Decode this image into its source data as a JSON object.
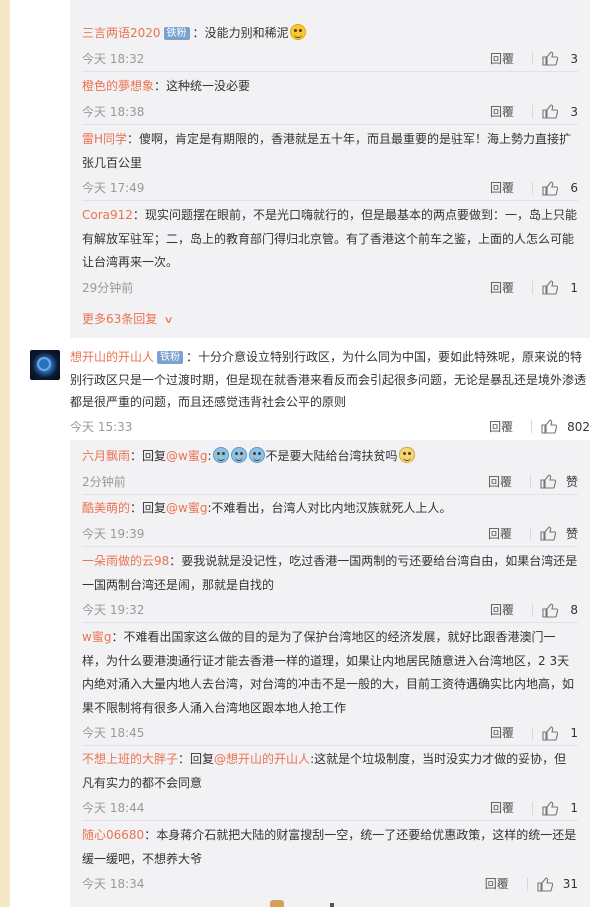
{
  "header": {
    "top_reply": "回覆",
    "top_like": "3"
  },
  "thread1": {
    "replies": [
      {
        "user": "三言两语2020",
        "badge": "铁粉",
        "text": "没能力别和稀泥",
        "emoji": "grin-emoji",
        "time": "今天 18:32",
        "reply": "回覆",
        "likes": "3"
      },
      {
        "user": "橙色的夢想象",
        "text": "这种统一没必要",
        "time": "今天 18:38",
        "reply": "回覆",
        "likes": "3"
      },
      {
        "user": "雷H同学",
        "text": "傻啊，肯定是有期限的，香港就是五十年，而且最重要的是驻军！海上勢力直接扩张几百公里",
        "time": "今天 17:49",
        "reply": "回覆",
        "likes": "6"
      },
      {
        "user": "Cora912",
        "text": "现实问题摆在眼前，不是光口嗨就行的，但是最基本的两点要做到：一，岛上只能有解放军驻军；二，岛上的教育部门得归北京管。有了香港这个前车之鉴，上面的人怎么可能让台湾再来一次。",
        "time": "29分钟前",
        "reply": "回覆",
        "likes": "1"
      }
    ],
    "more_label": "更多63条回复"
  },
  "main_comment": {
    "user": "想开山的开山人",
    "badge": "铁粉",
    "text": "十分介意设立特别行政区，为什么同为中国，要如此特殊呢，原来说的特别行政区只是一个过渡时期，但是现在就香港来看反而会引起很多问题，无论是暴乱还是境外渗透都是很严重的问题，而且还感觉违背社会公平的原则",
    "time": "今天 15:33",
    "reply": "回覆",
    "likes": "802"
  },
  "thread2": {
    "replies": [
      {
        "user": "六月飘雨",
        "prefix": "回复",
        "at": "@w蜜g",
        "text": "不是要大陆给台湾扶贫吗",
        "time": "2分钟前",
        "reply": "回覆",
        "likes": "赞"
      },
      {
        "user": "酷美萌的",
        "prefix": "回复",
        "at": "@w蜜g",
        "text": "不难看出，台湾人对比内地汉族就死人上人。",
        "time": "今天 19:39",
        "reply": "回覆",
        "likes": "赞"
      },
      {
        "user": "一朵雨做的云98",
        "text": "要我说就是没记性，吃过香港一国两制的亏还要给台湾自由，如果台湾还是一国两制台湾还是闹，那就是自找的",
        "time": "今天 19:32",
        "reply": "回覆",
        "likes": "8"
      },
      {
        "user": "w蜜g",
        "text": "不难看出国家这么做的目的是为了保护台湾地区的经济发展，就好比跟香港澳门一样，为什么要港澳通行证才能去香港一样的道理，如果让内地居民随意进入台湾地区，2 3天内绝对涌入大量内地人去台湾，对台湾的冲击不是一般的大，目前工资待遇确实比内地高，如果不限制将有很多人涌入台湾地区跟本地人抢工作",
        "time": "今天 18:45",
        "reply": "回覆",
        "likes": "1"
      },
      {
        "user": "不想上班的大胖子",
        "prefix": "回复",
        "at": "@想开山的开山人",
        "text": "这就是个垃圾制度，当时没实力才做的妥协，但凡有实力的都不会同意",
        "time": "今天 18:44",
        "reply": "回覆",
        "likes": "1"
      },
      {
        "user": "随心06680",
        "text": "本身蒋介石就把大陆的财富搜刮一空，统一了还要给优惠政策，这样的统一还是缓一缓吧，不想养大爷",
        "time": "今天 18:34",
        "reply": "回覆",
        "likes": "31"
      }
    ]
  },
  "colors": {
    "username": "#eb7350",
    "panel": "#f2f2f5",
    "strip": "#f4e9c4"
  }
}
